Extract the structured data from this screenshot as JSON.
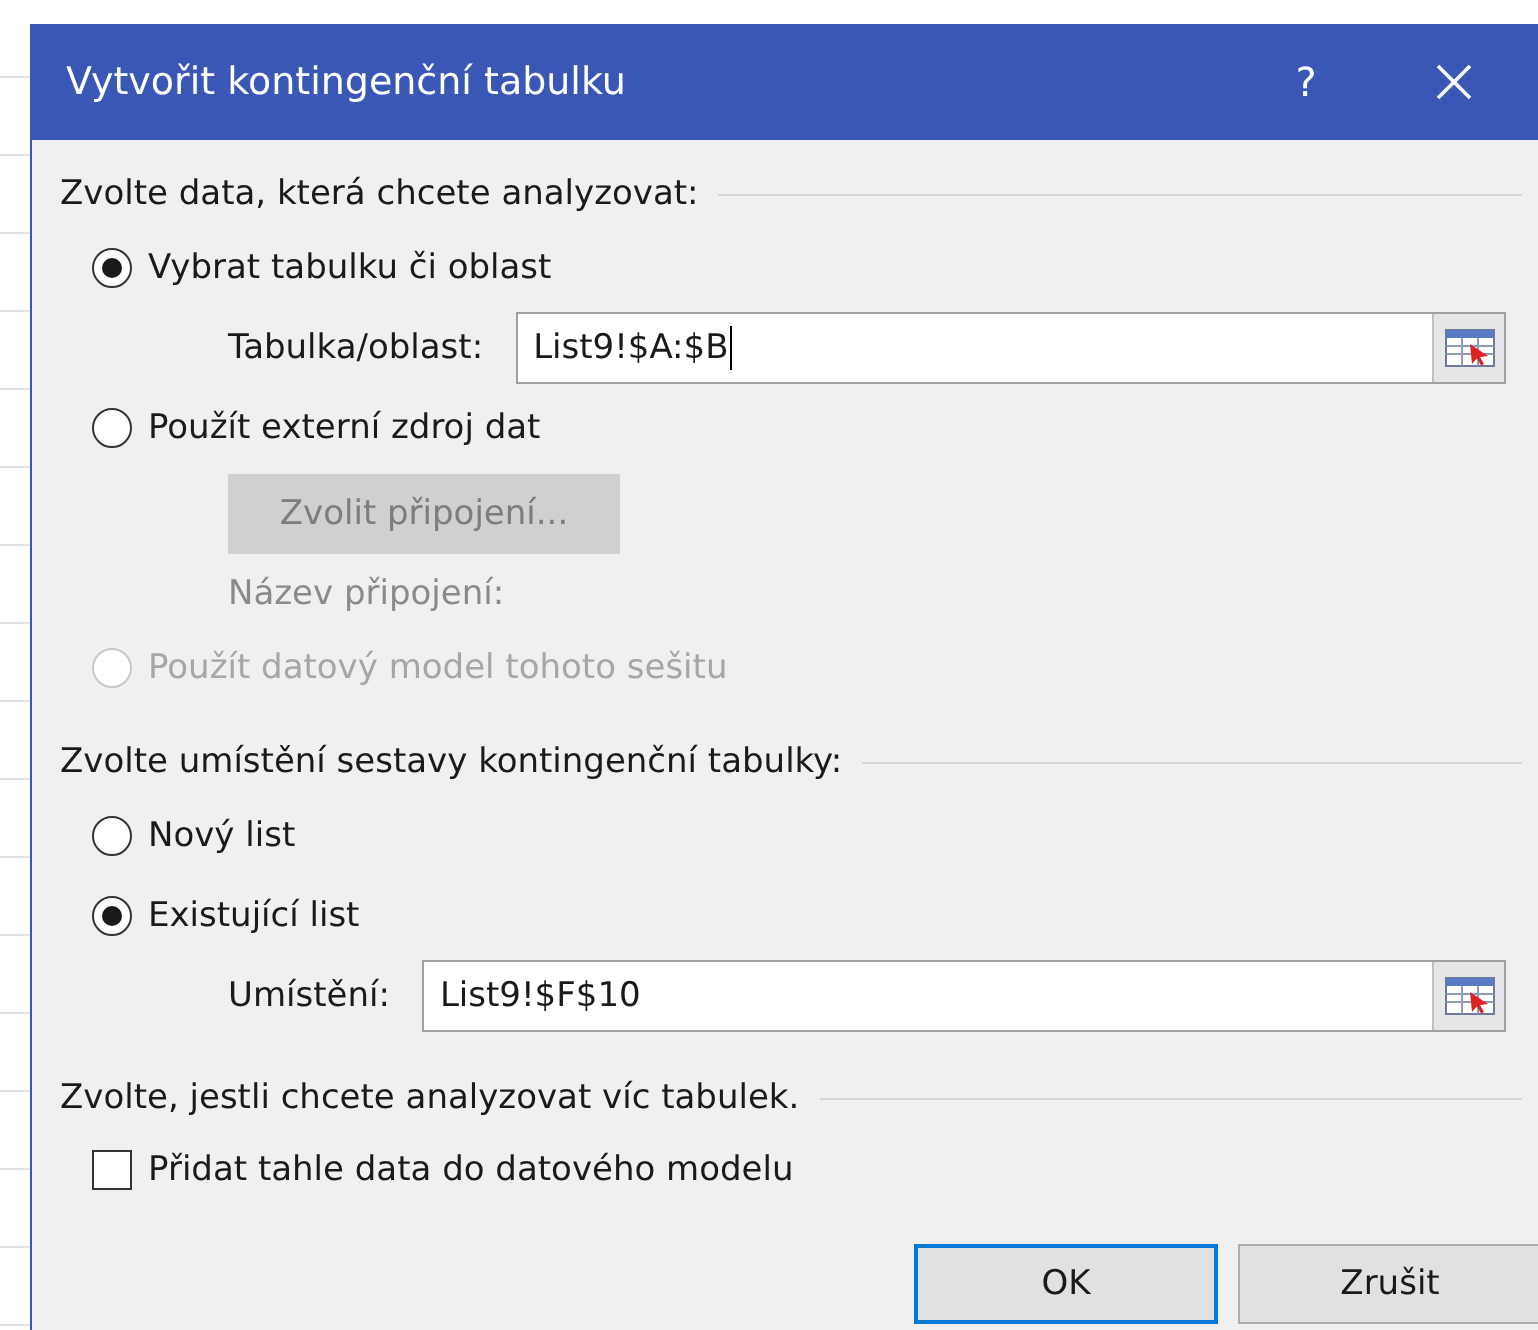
{
  "window": {
    "title": "Vytvořit kontingenční tabulku",
    "help": "?"
  },
  "sections": [
    {
      "heading": "Zvolte data, která chcete analyzovat:",
      "items": [
        {
          "kind": "radio",
          "label": "Vybrat tabulku či oblast",
          "selected": true,
          "disabled": false
        },
        {
          "kind": "field",
          "label": "Tabulka/oblast:",
          "value": "List9!$A:$B",
          "focused": true
        },
        {
          "kind": "radio",
          "label": "Použít externí zdroj dat",
          "selected": false,
          "disabled": false
        },
        {
          "kind": "button",
          "label": "Zvolit připojení...",
          "disabled": true
        },
        {
          "kind": "note",
          "label": "Název připojení:",
          "disabled": true
        },
        {
          "kind": "radio",
          "label": "Použít datový model tohoto sešitu",
          "selected": false,
          "disabled": true
        }
      ]
    },
    {
      "heading": "Zvolte umístění sestavy kontingenční tabulky:",
      "items": [
        {
          "kind": "radio",
          "label": "Nový list",
          "selected": false,
          "disabled": false
        },
        {
          "kind": "radio",
          "label": "Existující list",
          "selected": true,
          "disabled": false
        },
        {
          "kind": "field",
          "label": "Umístění:",
          "value": "List9!$F$10",
          "focused": false
        }
      ]
    },
    {
      "heading": "Zvolte, jestli chcete analyzovat víc tabulek.",
      "items": [
        {
          "kind": "check",
          "label": "Přidat tahle data do datového modelu",
          "checked": false
        }
      ]
    }
  ],
  "buttons": [
    {
      "label": "OK",
      "default": true
    },
    {
      "label": "Zrušit",
      "default": false
    }
  ]
}
